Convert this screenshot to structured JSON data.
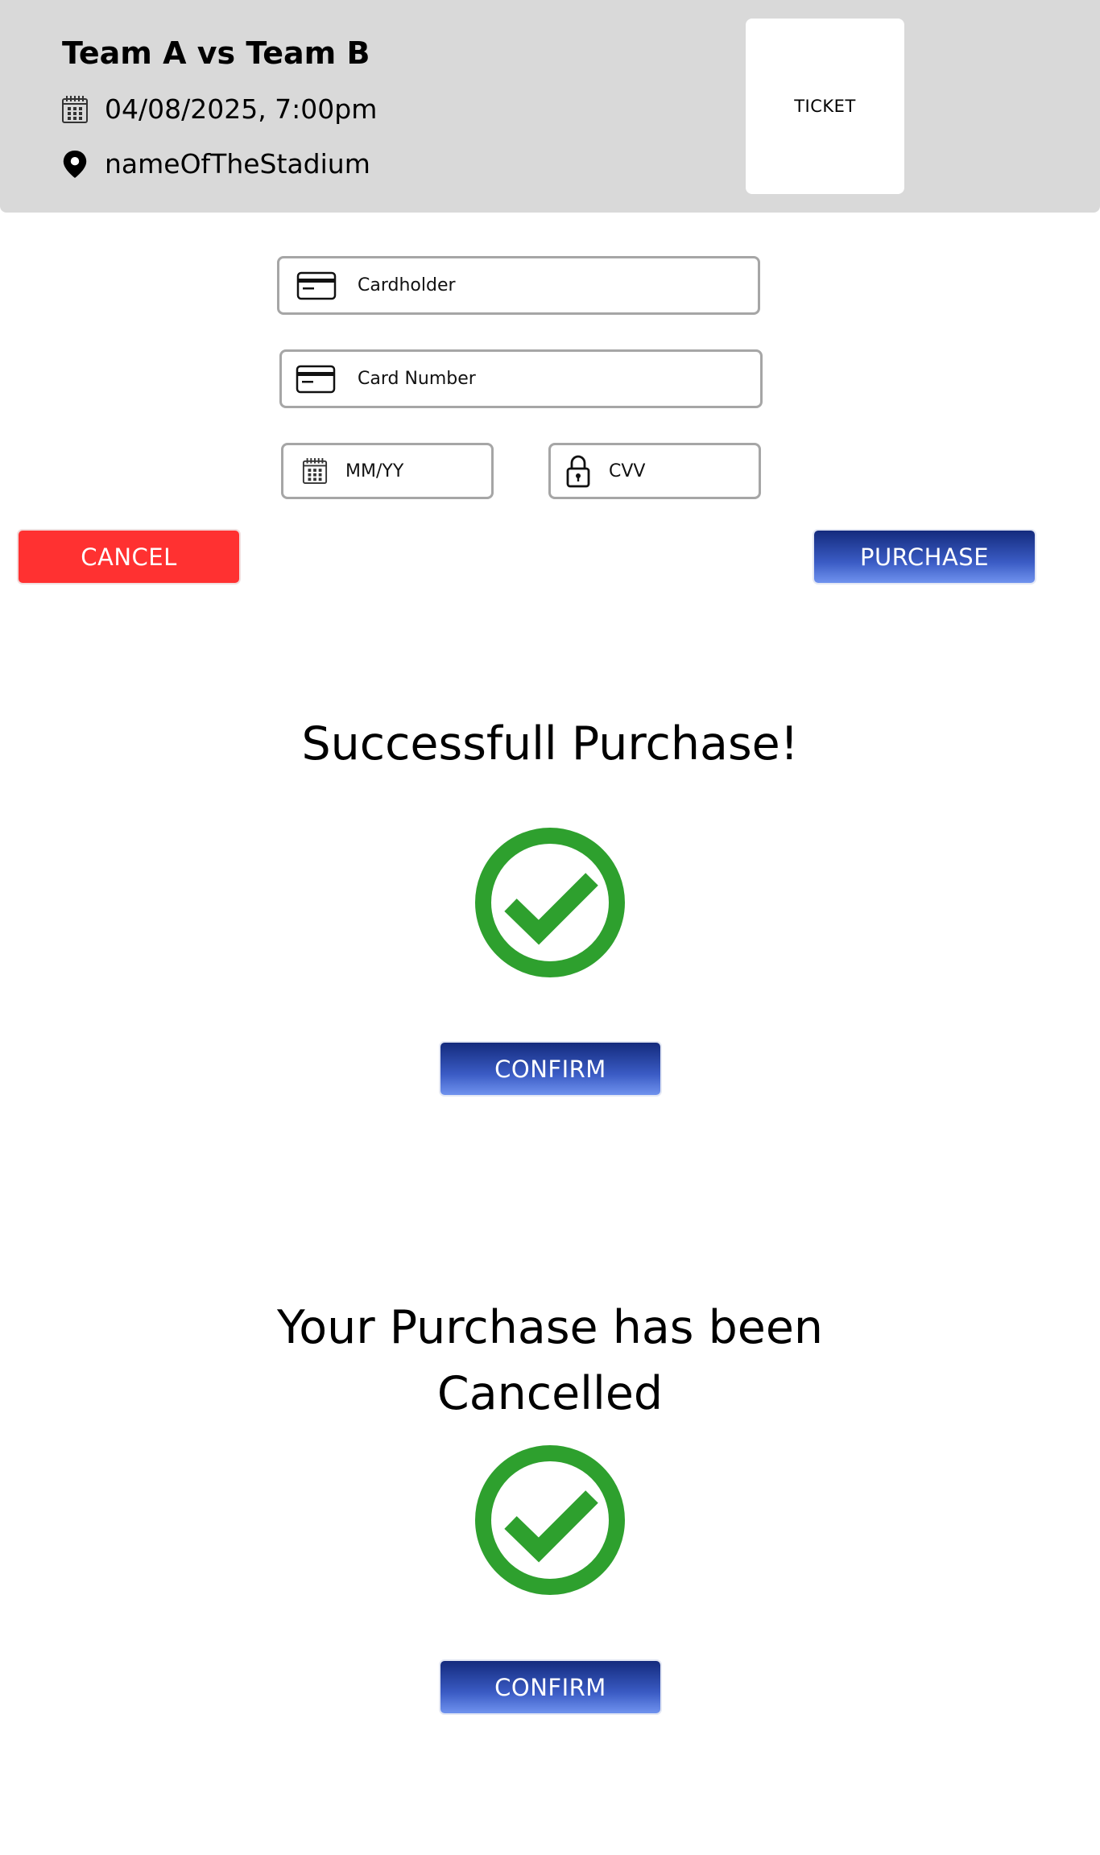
{
  "event": {
    "title": "Team A vs Team B",
    "datetime": "04/08/2025, 7:00pm",
    "venue": "nameOfTheStadium",
    "ticket_label": "TICKET"
  },
  "payment_form": {
    "cardholder_placeholder": "Cardholder",
    "card_number_placeholder": "Card Number",
    "expiry_placeholder": "MM/YY",
    "cvv_placeholder": "CVV"
  },
  "actions": {
    "cancel_label": "CANCEL",
    "purchase_label": "PURCHASE"
  },
  "success_state": {
    "message": "Successfull Purchase!",
    "confirm_label": "CONFIRM"
  },
  "cancelled_state": {
    "message_line1": "Your Purchase has been",
    "message_line2": "Cancelled",
    "confirm_label": "CONFIRM"
  },
  "icons": {
    "date": "calendar-icon",
    "venue": "location-pin-icon",
    "card": "credit-card-icon",
    "expiry": "calendar-icon",
    "cvv": "lock-icon",
    "status": "check-circle-icon"
  },
  "colors": {
    "header_bg": "#d9d9d9",
    "cancel": "#ff3131",
    "primary_top": "#142b7d",
    "primary_bottom": "#6f92ee",
    "success_green": "#2ea02e"
  }
}
